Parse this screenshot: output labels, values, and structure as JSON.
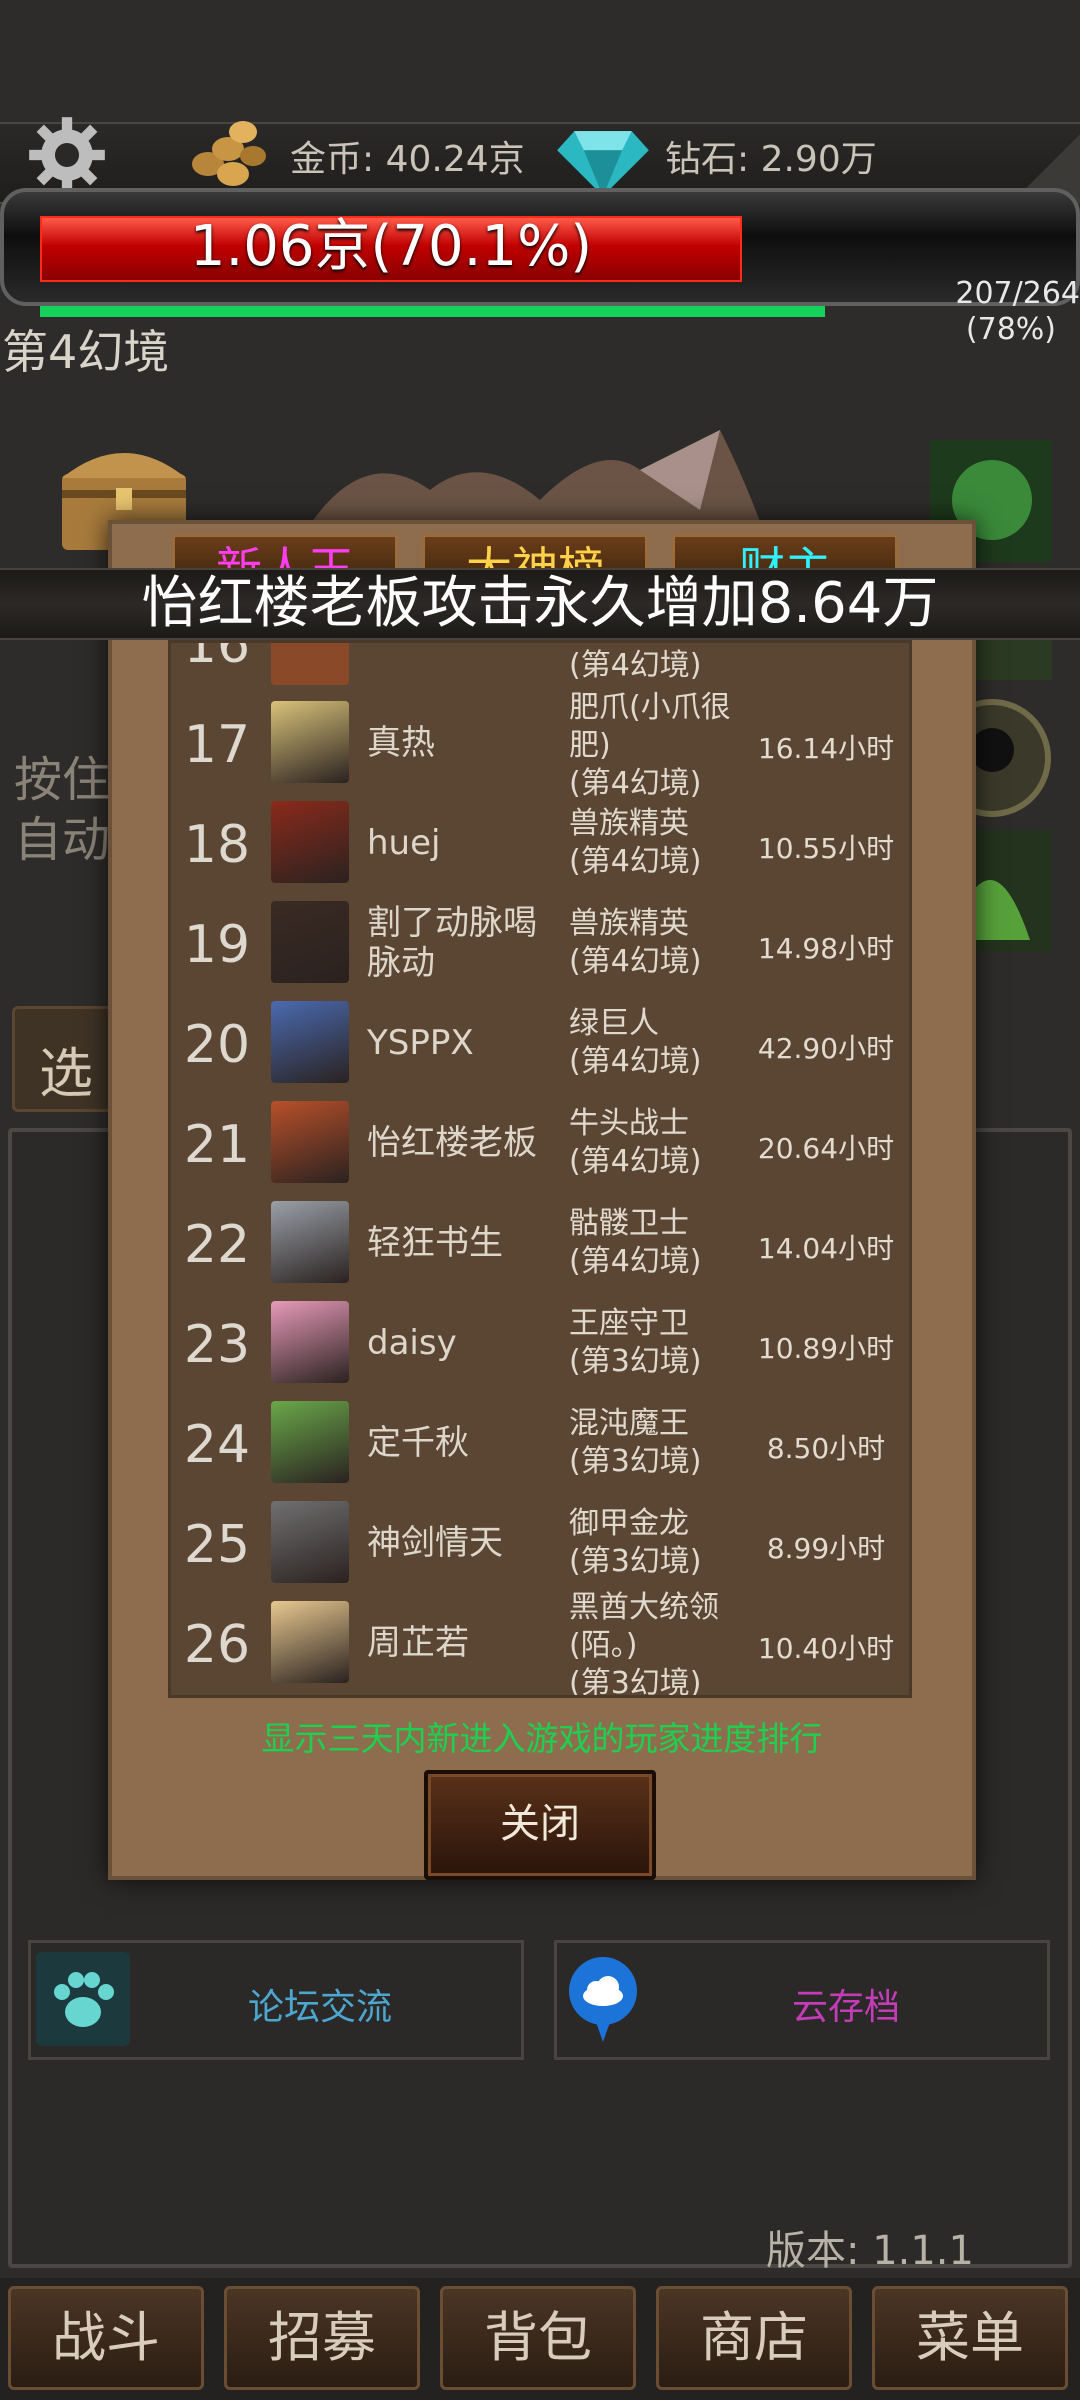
{
  "header": {
    "gold_label": "金币:  40.24京",
    "diamond_label": "钻石:  2.90万"
  },
  "boss": {
    "hp_text": "1.06京(70.1%)",
    "hp_fraction": 0.701,
    "stage_count": "207/264",
    "stage_percent": "(78%)",
    "stage_fraction": 0.78,
    "stage_name": "第4幻境"
  },
  "background": {
    "hint_line1": "按住",
    "hint_line2": "自动",
    "select_label": "选",
    "forum_label": "论坛交流",
    "cloud_label": "云存档",
    "version": "版本:  1.1.1"
  },
  "nav": {
    "battle": "战斗",
    "recruit": "招募",
    "bag": "背包",
    "shop": "商店",
    "menu": "菜单"
  },
  "modal": {
    "tabs": [
      "新人王",
      "大神榜",
      "财主"
    ],
    "partial_row": {
      "rank": "16",
      "boss": "(第4幻境)"
    },
    "rows": [
      {
        "rank": "17",
        "name": "真热",
        "boss": "肥爪(小爪很肥)\n(第4幻境)",
        "time": "16.14小时"
      },
      {
        "rank": "18",
        "name": "huej",
        "boss": "兽族精英\n(第4幻境)",
        "time": "10.55小时"
      },
      {
        "rank": "19",
        "name": "割了动脉喝脉动",
        "boss": "兽族精英\n(第4幻境)",
        "time": "14.98小时"
      },
      {
        "rank": "20",
        "name": "YSPPX",
        "boss": "绿巨人\n(第4幻境)",
        "time": "42.90小时"
      },
      {
        "rank": "21",
        "name": "怡红楼老板",
        "boss": "牛头战士\n(第4幻境)",
        "time": "20.64小时"
      },
      {
        "rank": "22",
        "name": "轻狂书生",
        "boss": "骷髅卫士\n(第4幻境)",
        "time": "14.04小时"
      },
      {
        "rank": "23",
        "name": "daisy",
        "boss": "王座守卫\n(第3幻境)",
        "time": "10.89小时"
      },
      {
        "rank": "24",
        "name": "定千秋",
        "boss": "混沌魔王\n(第3幻境)",
        "time": "8.50小时"
      },
      {
        "rank": "25",
        "name": "神剑情天",
        "boss": "御甲金龙\n(第3幻境)",
        "time": "8.99小时"
      },
      {
        "rank": "26",
        "name": "周芷若",
        "boss": "黑酋大统领(陌。)\n(第3幻境)",
        "time": "10.40小时"
      }
    ],
    "notice": "显示三天内新进入游戏的玩家进度排行",
    "close_label": "关闭"
  },
  "banner": {
    "text": "怡红楼老板攻击永久增加8.64万"
  },
  "colors": {
    "hp_red": "#c00000",
    "progress_green": "#14d25a",
    "notice_green": "#1fd04f",
    "forum_blue": "#4da6cf",
    "cloud_magenta": "#c43cb8",
    "tab_colors": [
      "#ff3df0",
      "#ffd24a",
      "#2ff0ff"
    ]
  },
  "icons": {
    "settings": "gear-icon",
    "gold": "gold-coins-icon",
    "diamond": "diamond-icon",
    "forum": "paw-icon",
    "cloud": "cloud-icon"
  }
}
